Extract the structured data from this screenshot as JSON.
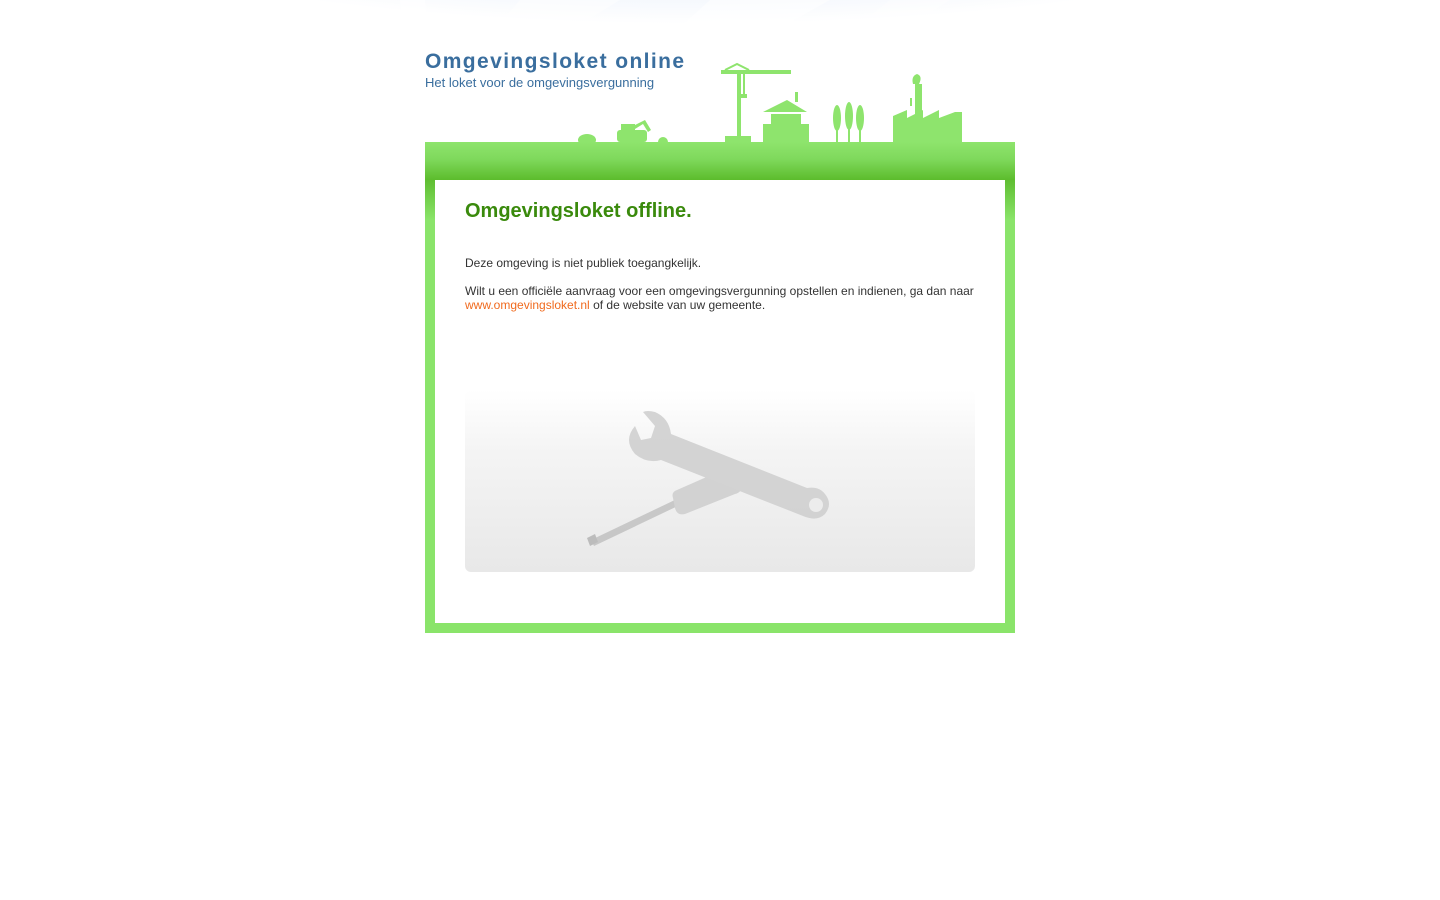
{
  "header": {
    "title": "Omgevingsloket online",
    "subtitle": "Het loket voor de omgevingsvergunning"
  },
  "content": {
    "title": "Omgevingsloket offline.",
    "paragraph1": "Deze omgeving is niet publiek toegangkelijk.",
    "paragraph2_before": "Wilt u een officiële aanvraag voor een omgevingsvergunning opstellen en indienen, ga dan naar ",
    "link_text": "www.omgevingsloket.nl",
    "paragraph2_after": " of de website van uw gemeente."
  },
  "colors": {
    "title_blue": "#3a6e9e",
    "heading_green": "#3a8a0c",
    "frame_green": "#8ae46a",
    "link_orange": "#f06a1e"
  },
  "icons": {
    "maintenance": "wrench-screwdriver-icon",
    "skyline": "construction-skyline"
  }
}
